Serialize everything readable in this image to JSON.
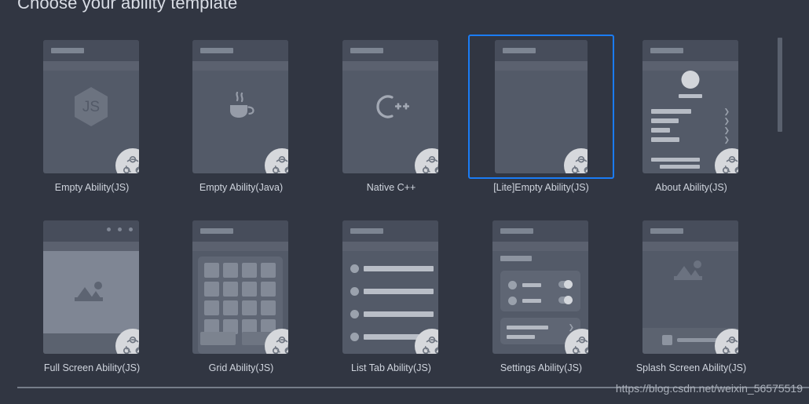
{
  "page": {
    "title": "Choose your ability template",
    "background_color": "#313642",
    "accent_color": "#1a7cf5",
    "label_color": "#cfd4dd"
  },
  "watermark": {
    "text": "https://blog.csdn.net/weixin_56575519"
  },
  "scrollbar": {
    "orientation": "vertical",
    "thumb_color": "#5a616e"
  },
  "templates": [
    {
      "id": "empty-ability-js",
      "label": "Empty Ability(JS)",
      "icon": "js-hexagon-icon",
      "badge": "harmony-service-icon",
      "selected": false
    },
    {
      "id": "empty-ability-java",
      "label": "Empty Ability(Java)",
      "icon": "java-coffee-cup-icon",
      "badge": "harmony-service-icon",
      "selected": false
    },
    {
      "id": "native-cpp",
      "label": "Native C++",
      "icon": "cpp-icon",
      "badge": "harmony-service-icon",
      "selected": false
    },
    {
      "id": "lite-empty-ability-js",
      "label": "[Lite]Empty Ability(JS)",
      "icon": "blank-screen-icon",
      "badge": "harmony-service-icon",
      "selected": true
    },
    {
      "id": "about-ability-js",
      "label": "About Ability(JS)",
      "icon": "profile-list-icon",
      "badge": "harmony-service-icon",
      "selected": false
    },
    {
      "id": "full-screen-ability-js",
      "label": "Full Screen Ability(JS)",
      "icon": "image-placeholder-icon",
      "badge": "harmony-service-icon",
      "selected": false
    },
    {
      "id": "grid-ability-js",
      "label": "Grid Ability(JS)",
      "icon": "grid-icon",
      "badge": "harmony-service-icon",
      "selected": false
    },
    {
      "id": "list-tab-ability-js",
      "label": "List Tab Ability(JS)",
      "icon": "list-icon",
      "badge": "harmony-service-icon",
      "selected": false
    },
    {
      "id": "settings-ability-js",
      "label": "Settings Ability(JS)",
      "icon": "settings-list-icon",
      "badge": "harmony-service-icon",
      "selected": false
    },
    {
      "id": "splash-screen-ability-js",
      "label": "Splash Screen Ability(JS)",
      "icon": "splash-image-icon",
      "badge": "harmony-service-icon",
      "selected": false
    }
  ]
}
